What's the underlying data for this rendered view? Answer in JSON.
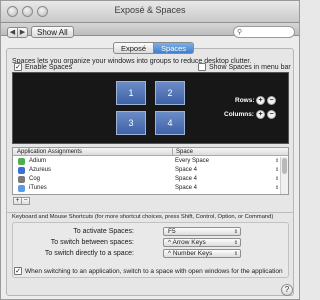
{
  "window": {
    "title": "Exposé & Spaces"
  },
  "toolbar": {
    "show_all_label": "Show All",
    "back_glyph": "◀",
    "forward_glyph": "▶",
    "search_icon": "search-icon"
  },
  "tabs": [
    {
      "label": "Exposé",
      "selected": false
    },
    {
      "label": "Spaces",
      "selected": true
    }
  ],
  "spaces": {
    "description": "Spaces lets you organize your windows into groups to reduce desktop clutter.",
    "enable_label": "Enable Spaces",
    "enable_checked": true,
    "menu_bar_label": "Show Spaces in menu bar",
    "menu_bar_checked": false,
    "grid": [
      "1",
      "2",
      "3",
      "4"
    ],
    "rows_label": "Rows:",
    "columns_label": "Columns:",
    "plus": "+",
    "minus": "−"
  },
  "assignments": {
    "col_app": "Application Assignments",
    "col_space": "Space",
    "rows": [
      {
        "name": "Adium",
        "space": "Every Space",
        "color": "#4caf50"
      },
      {
        "name": "Azureus",
        "space": "Space 4",
        "color": "#3b6fd6"
      },
      {
        "name": "Cog",
        "space": "Space 4",
        "color": "#7a7a7a"
      },
      {
        "name": "iTunes",
        "space": "Space 4",
        "color": "#5a9be6"
      }
    ],
    "add": "+",
    "remove": "−"
  },
  "shortcuts": {
    "heading": "Keyboard and Mouse Shortcuts (for more shortcut choices, press Shift, Control, Option, or Command)",
    "activate_label": "To activate Spaces:",
    "activate_value": "F5",
    "between_label": "To switch between spaces:",
    "between_value": "^ Arrow Keys",
    "direct_label": "To switch directly to a space:",
    "direct_value": "^ Number Keys",
    "switch_app_label": "When switching to an application, switch to a space with open windows for the application",
    "switch_app_checked": true
  },
  "help_glyph": "?",
  "colors": {
    "accent": "#3f7fcf",
    "space_tile": "#4f72b5",
    "grid_bg": "#171717"
  }
}
